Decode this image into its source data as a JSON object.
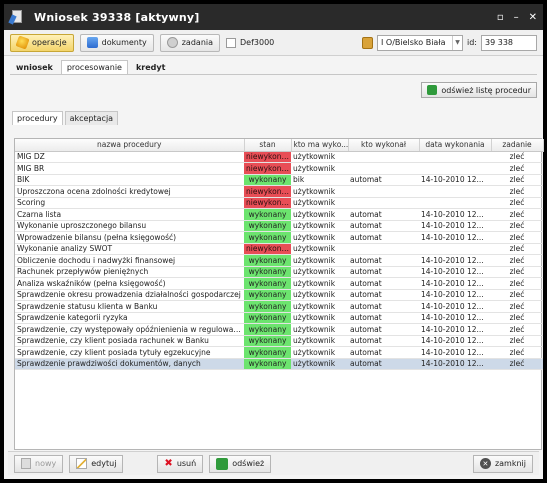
{
  "window": {
    "title": "Wniosek 39338 [aktywny]"
  },
  "toolbar": {
    "operations_label": "operacje",
    "documents_label": "dokumenty",
    "tasks_label": "zadania",
    "def_label": "Def3000",
    "branch_value": "I O/Bielsko Biała",
    "id_label": "id:",
    "id_value": "39 338"
  },
  "tabs": [
    "wniosek",
    "procesowanie",
    "kredyt"
  ],
  "refresh_button": "odśwież listę procedur",
  "subtabs": [
    "procedury",
    "akceptacja"
  ],
  "table": {
    "columns": [
      "nazwa procedury",
      "stan",
      "kto ma wyko...",
      "kto wykonał",
      "data wykonania",
      "zadanie"
    ],
    "rows": [
      {
        "name": "MIG DZ",
        "stan": "niewykonany",
        "kto": "użytkownik",
        "wykonal": "",
        "data": "",
        "zadanie": "zleć"
      },
      {
        "name": "MIG BR",
        "stan": "niewykonany",
        "kto": "użytkownik",
        "wykonal": "",
        "data": "",
        "zadanie": "zleć"
      },
      {
        "name": "BIK",
        "stan": "wykonany",
        "kto": "bik",
        "wykonal": "automat",
        "data": "14-10-2010 12...",
        "zadanie": "zleć"
      },
      {
        "name": "Uproszczona ocena zdolności kredytowej",
        "stan": "niewykonany",
        "kto": "użytkownik",
        "wykonal": "",
        "data": "",
        "zadanie": "zleć"
      },
      {
        "name": "Scoring",
        "stan": "niewykonany",
        "kto": "użytkownik",
        "wykonal": "",
        "data": "",
        "zadanie": "zleć"
      },
      {
        "name": "Czarna lista",
        "stan": "wykonany",
        "kto": "użytkownik",
        "wykonal": "automat",
        "data": "14-10-2010 12...",
        "zadanie": "zleć"
      },
      {
        "name": "Wykonanie uproszczonego bilansu",
        "stan": "wykonany",
        "kto": "użytkownik",
        "wykonal": "automat",
        "data": "14-10-2010 12...",
        "zadanie": "zleć"
      },
      {
        "name": "Wprowadzenie bilansu (pełna księgowość)",
        "stan": "wykonany",
        "kto": "użytkownik",
        "wykonal": "automat",
        "data": "14-10-2010 12...",
        "zadanie": "zleć"
      },
      {
        "name": "Wykonanie analizy SWOT",
        "stan": "niewykonany",
        "kto": "użytkownik",
        "wykonal": "",
        "data": "",
        "zadanie": "zleć"
      },
      {
        "name": "Obliczenie dochodu i nadwyżki finansowej",
        "stan": "wykonany",
        "kto": "użytkownik",
        "wykonal": "automat",
        "data": "14-10-2010 12...",
        "zadanie": "zleć"
      },
      {
        "name": "Rachunek przepływów pieniężnych",
        "stan": "wykonany",
        "kto": "użytkownik",
        "wykonal": "automat",
        "data": "14-10-2010 12...",
        "zadanie": "zleć"
      },
      {
        "name": "Analiza wskaźników (pełna księgowość)",
        "stan": "wykonany",
        "kto": "użytkownik",
        "wykonal": "automat",
        "data": "14-10-2010 12...",
        "zadanie": "zleć"
      },
      {
        "name": "Sprawdzenie okresu prowadzenia działalności gospodarczej",
        "stan": "wykonany",
        "kto": "użytkownik",
        "wykonal": "automat",
        "data": "14-10-2010 12...",
        "zadanie": "zleć"
      },
      {
        "name": "Sprawdzenie statusu klienta w Banku",
        "stan": "wykonany",
        "kto": "użytkownik",
        "wykonal": "automat",
        "data": "14-10-2010 12...",
        "zadanie": "zleć"
      },
      {
        "name": "Sprawdzenie kategorii ryzyka",
        "stan": "wykonany",
        "kto": "użytkownik",
        "wykonal": "automat",
        "data": "14-10-2010 12...",
        "zadanie": "zleć"
      },
      {
        "name": "Sprawdzenie, czy występowały opóźnienienia w regulowaniu ...",
        "stan": "wykonany",
        "kto": "użytkownik",
        "wykonal": "automat",
        "data": "14-10-2010 12...",
        "zadanie": "zleć"
      },
      {
        "name": "Sprawdzenie, czy klient posiada rachunek w Banku",
        "stan": "wykonany",
        "kto": "użytkownik",
        "wykonal": "automat",
        "data": "14-10-2010 12...",
        "zadanie": "zleć"
      },
      {
        "name": "Sprawdzenie, czy klient posiada tytuły egzekucyjne",
        "stan": "wykonany",
        "kto": "użytkownik",
        "wykonal": "automat",
        "data": "14-10-2010 12...",
        "zadanie": "zleć"
      },
      {
        "name": "Sprawdzenie prawdziwości dokumentów, danych",
        "stan": "wykonany",
        "kto": "użytkownik",
        "wykonal": "automat",
        "data": "14-10-2010 12...",
        "zadanie": "zleć",
        "selected": true
      }
    ]
  },
  "bottom": {
    "new_label": "nowy",
    "edit_label": "edytuj",
    "delete_label": "usuń",
    "refresh_label": "odśwież",
    "close_label": "zamknij"
  },
  "colors": {
    "done": "#6ce46e",
    "not_done": "#e84e56",
    "titlebar": "#2a2a2a",
    "selected_row": "#cdd9e8"
  }
}
